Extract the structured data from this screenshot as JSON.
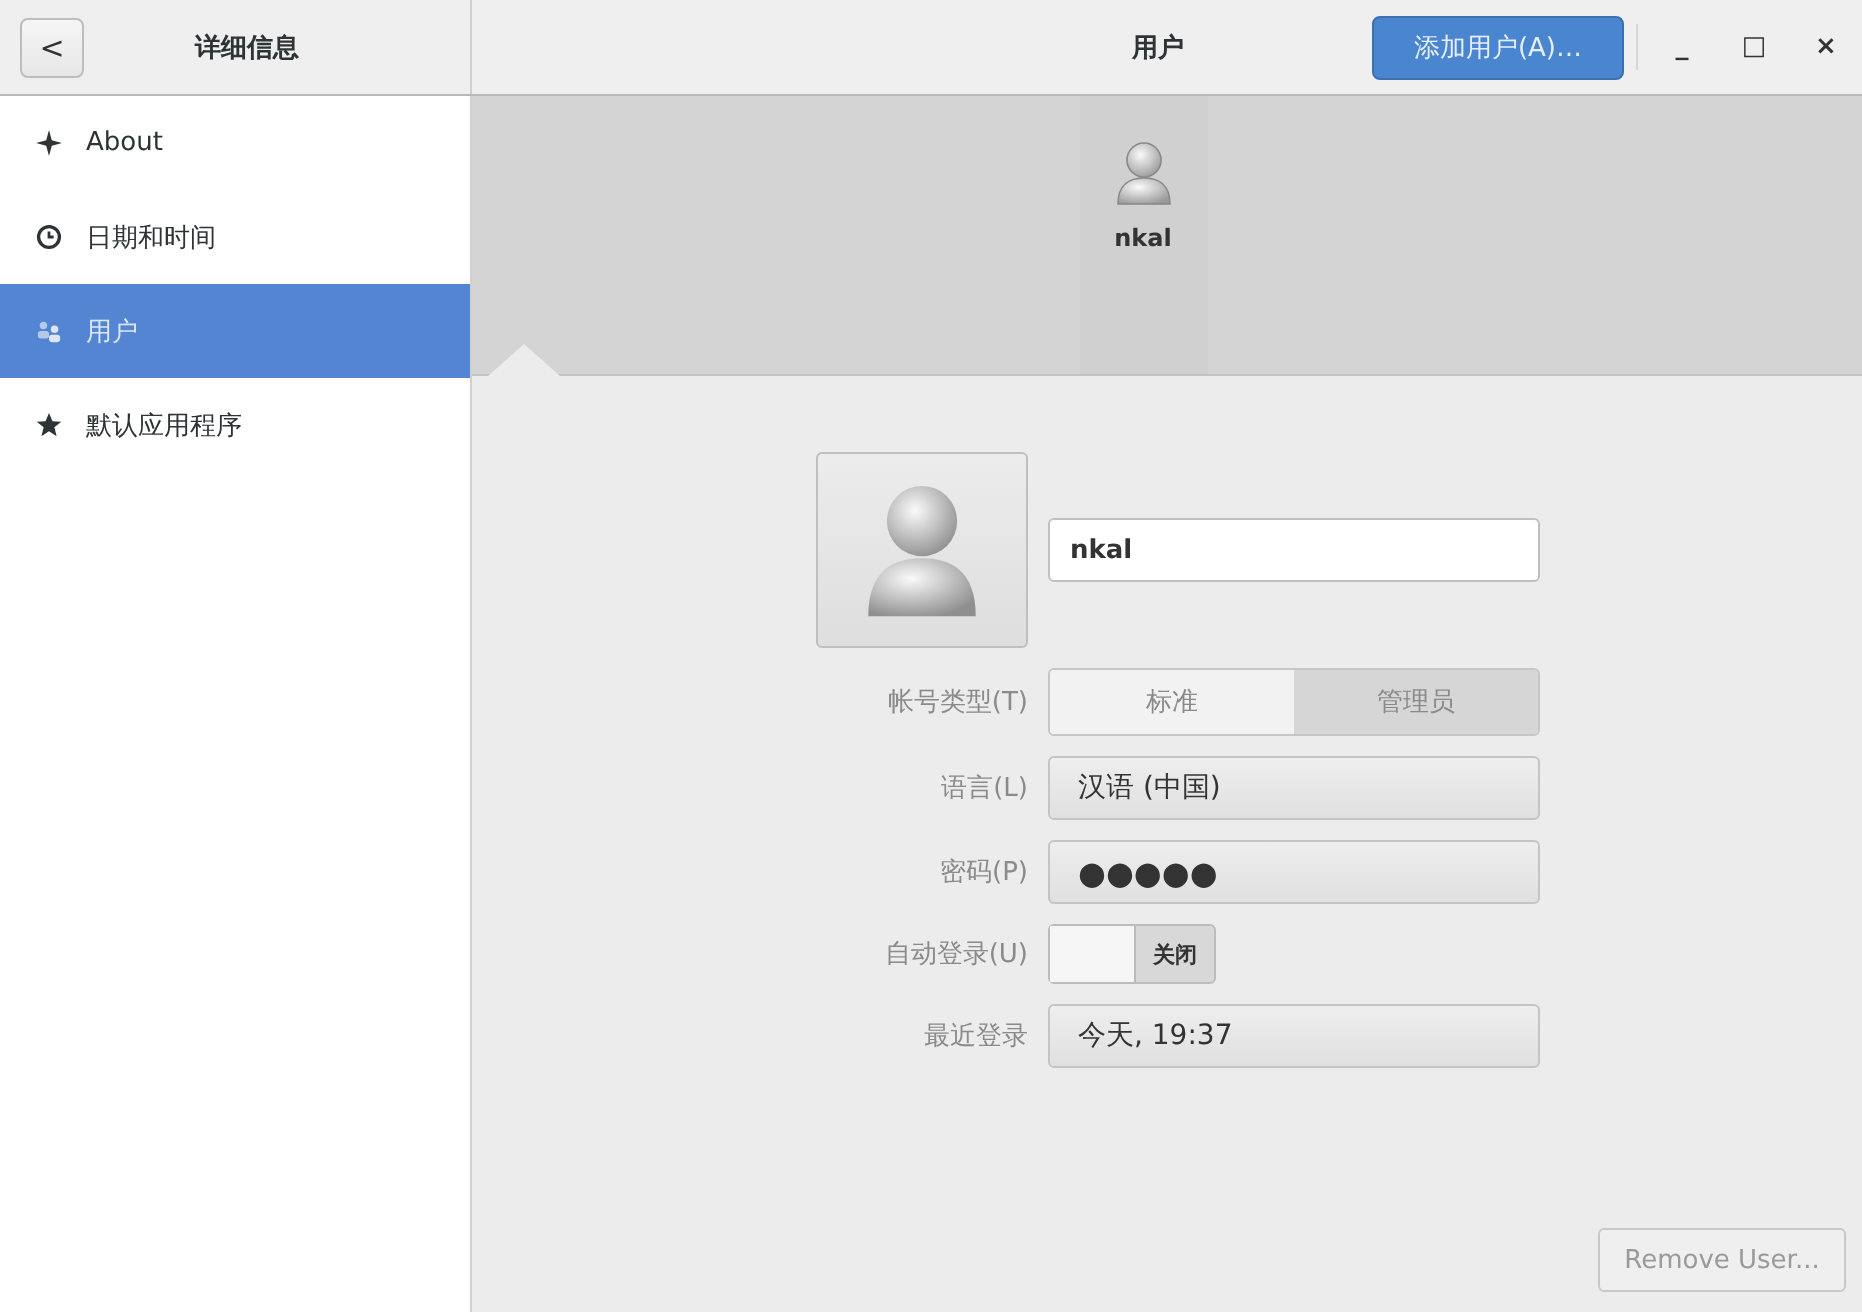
{
  "header": {
    "back_button": "<",
    "left_title": "详细信息",
    "title": "用户",
    "add_button": "添加用户(A)…",
    "window_controls": [
      "_",
      "□",
      "×"
    ]
  },
  "sidebar": {
    "items": [
      {
        "label": "About",
        "kind": "sparkle",
        "selected": false
      },
      {
        "label": "日期和时间",
        "kind": "clock",
        "selected": false
      },
      {
        "label": "用户",
        "kind": "users",
        "selected": true
      },
      {
        "label": "默认应用程序",
        "kind": "star",
        "selected": false
      }
    ]
  },
  "user_strip": {
    "users": [
      {
        "name": "nkal"
      }
    ]
  },
  "form": {
    "name": "nkal",
    "account_type": {
      "label": "帐号类型(T)",
      "options": [
        {
          "label": "标准",
          "selected": false
        },
        {
          "label": "管理员",
          "selected": true
        }
      ]
    },
    "language": {
      "label": "语言(L)",
      "value": "汉语 (中国)"
    },
    "password": {
      "label": "密码(P)",
      "value": "●●●●●"
    },
    "autologin": {
      "label": "自动登录(U)",
      "on": false,
      "state_text": "关闭"
    },
    "last_login": {
      "label": "最近登录",
      "value": "今天, 19:37"
    }
  },
  "remove_button": {
    "label": "Remove User...",
    "disabled": true
  }
}
